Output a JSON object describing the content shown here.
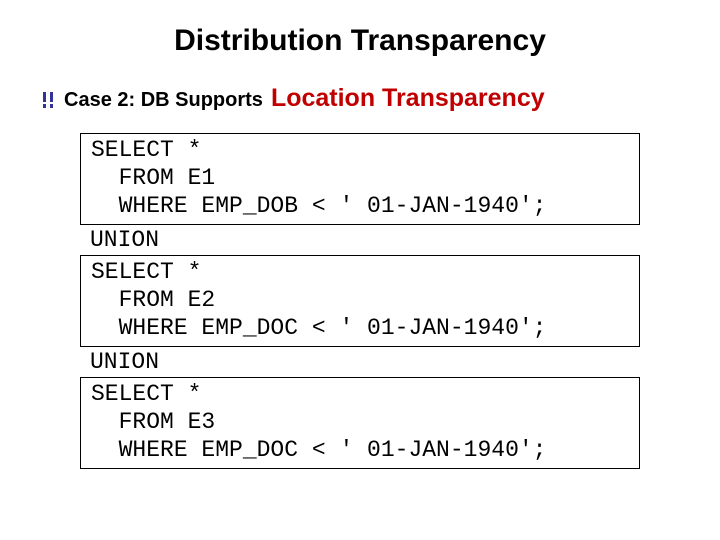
{
  "title": "Distribution Transparency",
  "subtitle_lead": "Case 2: DB Supports",
  "subtitle_strong": "Location Transparency",
  "sql_block_1": "SELECT *\n  FROM E1\n  WHERE EMP_DOB < ' 01-JAN-1940';",
  "union_1": "UNION",
  "sql_block_2": "SELECT *\n  FROM E2\n  WHERE EMP_DOC < ' 01-JAN-1940';",
  "union_2": "UNION",
  "sql_block_3": "SELECT *\n  FROM E3\n  WHERE EMP_DOC < ' 01-JAN-1940';",
  "chart_data": {
    "type": "table",
    "title": "SQL queries for Location Transparency (Case 2)",
    "blocks": [
      {
        "sql": "SELECT * FROM E1 WHERE EMP_DOB < '01-JAN-1940';"
      },
      {
        "op": "UNION"
      },
      {
        "sql": "SELECT * FROM E2 WHERE EMP_DOC < '01-JAN-1940';"
      },
      {
        "op": "UNION"
      },
      {
        "sql": "SELECT * FROM E3 WHERE EMP_DOC < '01-JAN-1940';"
      }
    ]
  }
}
